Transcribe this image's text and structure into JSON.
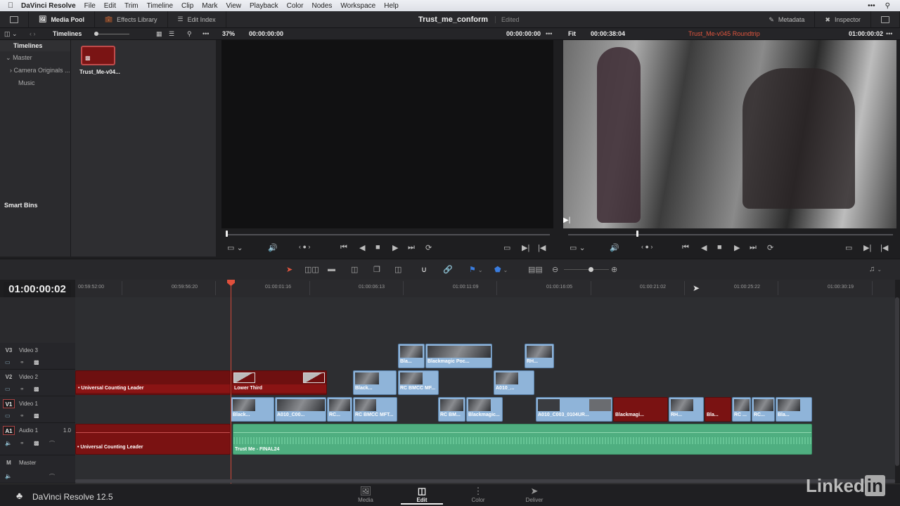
{
  "menubar": {
    "apple": "",
    "app": "DaVinci Resolve",
    "items": [
      "File",
      "Edit",
      "Trim",
      "Timeline",
      "Clip",
      "Mark",
      "View",
      "Playback",
      "Color",
      "Nodes",
      "Workspace",
      "Help"
    ],
    "right_icons": [
      "more-icon",
      "spotlight-search-icon"
    ]
  },
  "toolbar": {
    "media_pool": "Media Pool",
    "effects_library": "Effects Library",
    "edit_index": "Edit Index",
    "project_title": "Trust_me_conform",
    "project_status": "Edited",
    "metadata": "Metadata",
    "inspector": "Inspector"
  },
  "subheader": {
    "bin_title": "Timelines",
    "source_zoom": "37%",
    "source_tc_left": "00:00:00:00",
    "source_tc_right": "00:00:00:00",
    "timeline_zoom": "Fit",
    "timeline_duration": "00:00:38:04",
    "timeline_name": "Trust_Me-v045 Roundtrip",
    "timeline_tc": "01:00:00:02",
    "timeline_name_color": "#e0553e"
  },
  "bins": {
    "header": "Timelines",
    "items": [
      {
        "label": "Master",
        "expanded": true
      },
      {
        "label": "Camera Originals ...",
        "expanded": false
      },
      {
        "label": "Music"
      }
    ],
    "smart_bins": "Smart Bins"
  },
  "clips": [
    {
      "label": "Trust_Me-v04..."
    }
  ],
  "timecode": "01:00:00:02",
  "ruler": [
    "00:59:52:00",
    "00:59:56:20",
    "01:00:01:16",
    "01:00:06:13",
    "01:00:11:09",
    "01:00:16:05",
    "01:00:21:02",
    "01:00:25:22",
    "01:00:30:19"
  ],
  "tracks": [
    {
      "id": "V3",
      "name": "Video 3"
    },
    {
      "id": "V2",
      "name": "Video 2"
    },
    {
      "id": "V1",
      "name": "Video 1"
    },
    {
      "id": "A1",
      "name": "Audio 1",
      "level": "1.0"
    },
    {
      "id": "M",
      "name": "Master"
    }
  ],
  "timeline_clips": {
    "v3": [
      "Bla...",
      "Blackmagic Poc...",
      "RH..."
    ],
    "v2": [
      "• Universal Counting Leader",
      "Lower Third",
      "Black...",
      "RC BMCC MF...",
      "A010_..."
    ],
    "v1": [
      "Black...",
      "A010_C00...",
      "RC...",
      "RC BMCC MFT...",
      "RC BM...",
      "Blackmagic...",
      "A010_C003_0104UR...",
      "Blackmagi...",
      "RH...",
      "Bla...",
      "RC ...",
      "RC...",
      "Bla..."
    ],
    "a1": [
      "• Universal Counting Leader",
      "Trust Me - FINAL24"
    ]
  },
  "bottombar": {
    "app_version": "DaVinci Resolve 12.5",
    "pages": [
      "Media",
      "Edit",
      "Color",
      "Deliver"
    ],
    "active_page": "Edit",
    "watermark": "Linked"
  },
  "watermark_in": "in"
}
